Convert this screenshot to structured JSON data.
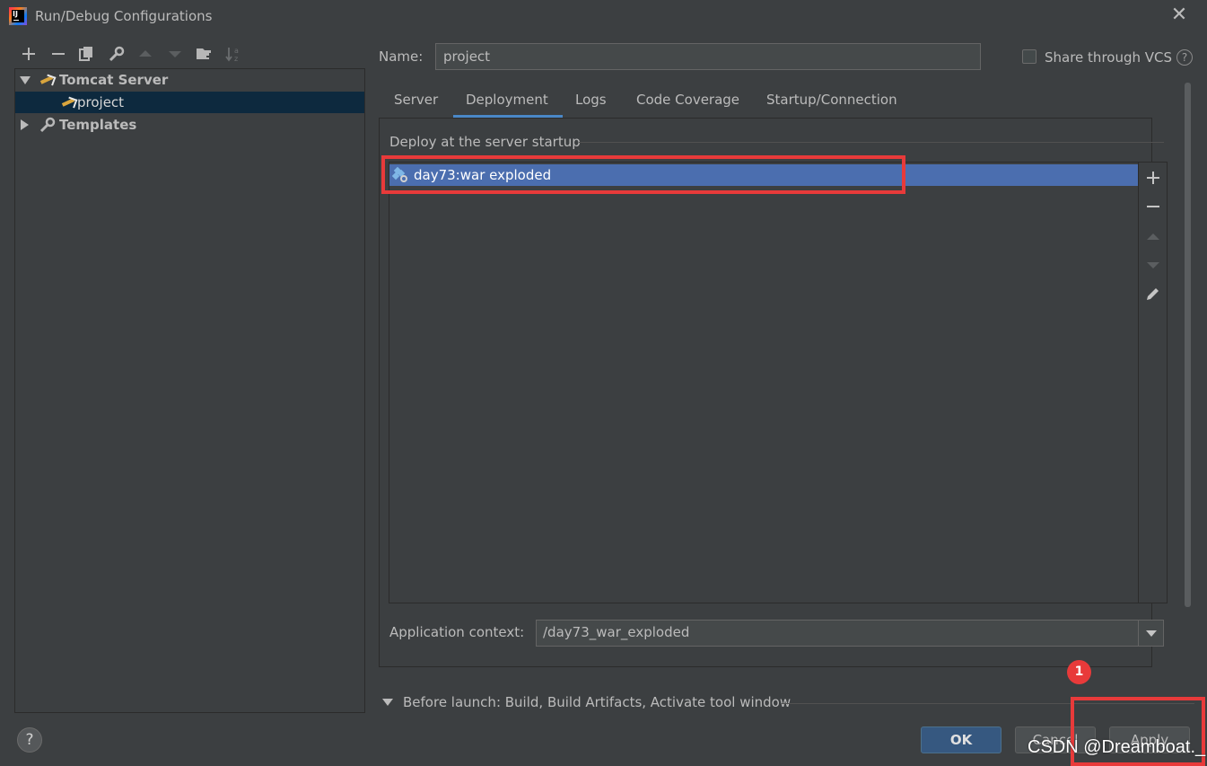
{
  "window": {
    "title": "Run/Debug Configurations",
    "app_icon": "intellij-idea-icon",
    "close_icon": "close-x-icon"
  },
  "toolbar": {
    "icons": [
      "plus-icon",
      "minus-icon",
      "copy-icon",
      "wrench-icon",
      "arrow-up-icon",
      "arrow-down-icon",
      "folder-add-icon",
      "sort-icon"
    ]
  },
  "tree": {
    "items": [
      {
        "label": "Tomcat Server",
        "expanded": true,
        "icon": "tomcat-icon"
      },
      {
        "label": "project",
        "selected": true,
        "icon": "tomcat-icon"
      },
      {
        "label": "Templates",
        "expanded": false,
        "icon": "wrench-icon"
      }
    ]
  },
  "config": {
    "name_label": "Name:",
    "name_value": "project",
    "share_label": "Share through VCS",
    "share_checked": false,
    "help_icon": "?"
  },
  "tabs": [
    {
      "label": "Server",
      "active": false
    },
    {
      "label": "Deployment",
      "active": true
    },
    {
      "label": "Logs",
      "active": false
    },
    {
      "label": "Code Coverage",
      "active": false
    },
    {
      "label": "Startup/Connection",
      "active": false
    }
  ],
  "deployment": {
    "section_title": "Deploy at the server startup",
    "items": [
      "day73:war exploded"
    ],
    "side_buttons": [
      "plus-icon",
      "minus-icon",
      "move-up-icon",
      "move-down-icon",
      "edit-pencil-icon"
    ],
    "context_label": "Application context:",
    "context_value": "/day73_war_exploded"
  },
  "before_launch": {
    "label": "Before launch: Build, Build Artifacts, Activate tool window"
  },
  "buttons": {
    "help": "?",
    "ok": "OK",
    "cancel": "Cancel",
    "apply": "Apply"
  },
  "annotations": {
    "badge": "1",
    "color": "#e83a3a"
  },
  "watermark": "CSDN @Dreamboat._",
  "colors": {
    "background": "#3c3f41",
    "selection": "#4b6eaf",
    "tree_selection": "#0d293e",
    "tab_underline": "#4a88c7",
    "ok_button": "#365880"
  }
}
